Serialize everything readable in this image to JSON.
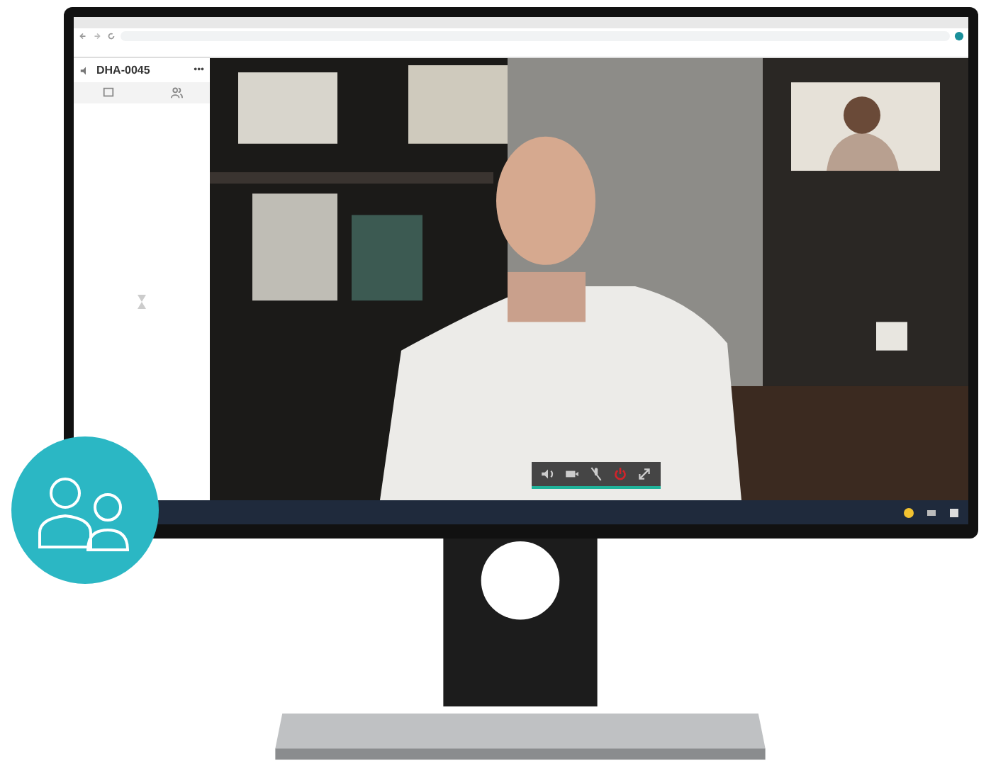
{
  "call": {
    "title": "DHA-0045",
    "more": "•••"
  },
  "controls": [
    {
      "kind": "speaker"
    },
    {
      "kind": "camera"
    },
    {
      "kind": "mic-off"
    },
    {
      "kind": "hangup"
    },
    {
      "kind": "expand"
    }
  ]
}
